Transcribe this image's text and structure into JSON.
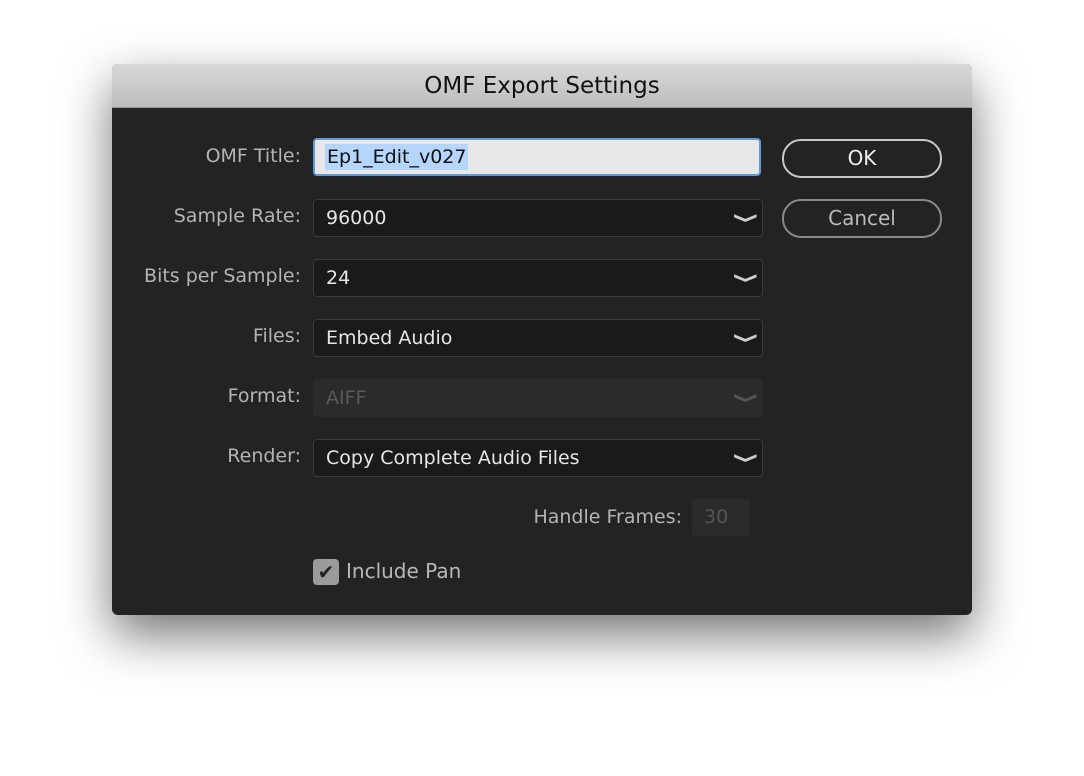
{
  "dialog": {
    "title": "OMF Export Settings"
  },
  "fields": {
    "omf_title": {
      "label": "OMF Title:",
      "value": "Ep1_Edit_v027"
    },
    "sample_rate": {
      "label": "Sample Rate:",
      "value": "96000"
    },
    "bits_per_sample": {
      "label": "Bits per Sample:",
      "value": "24"
    },
    "files": {
      "label": "Files:",
      "value": "Embed Audio"
    },
    "format": {
      "label": "Format:",
      "value": "AIFF",
      "disabled": true
    },
    "render": {
      "label": "Render:",
      "value": "Copy Complete Audio Files"
    },
    "handle_frames": {
      "label": "Handle Frames:",
      "value": "30",
      "disabled": true
    },
    "include_pan": {
      "label": "Include Pan",
      "checked": true
    }
  },
  "buttons": {
    "ok": "OK",
    "cancel": "Cancel"
  },
  "icons": {
    "dropdown": "chevron-down-icon",
    "check": "checkmark-icon"
  }
}
